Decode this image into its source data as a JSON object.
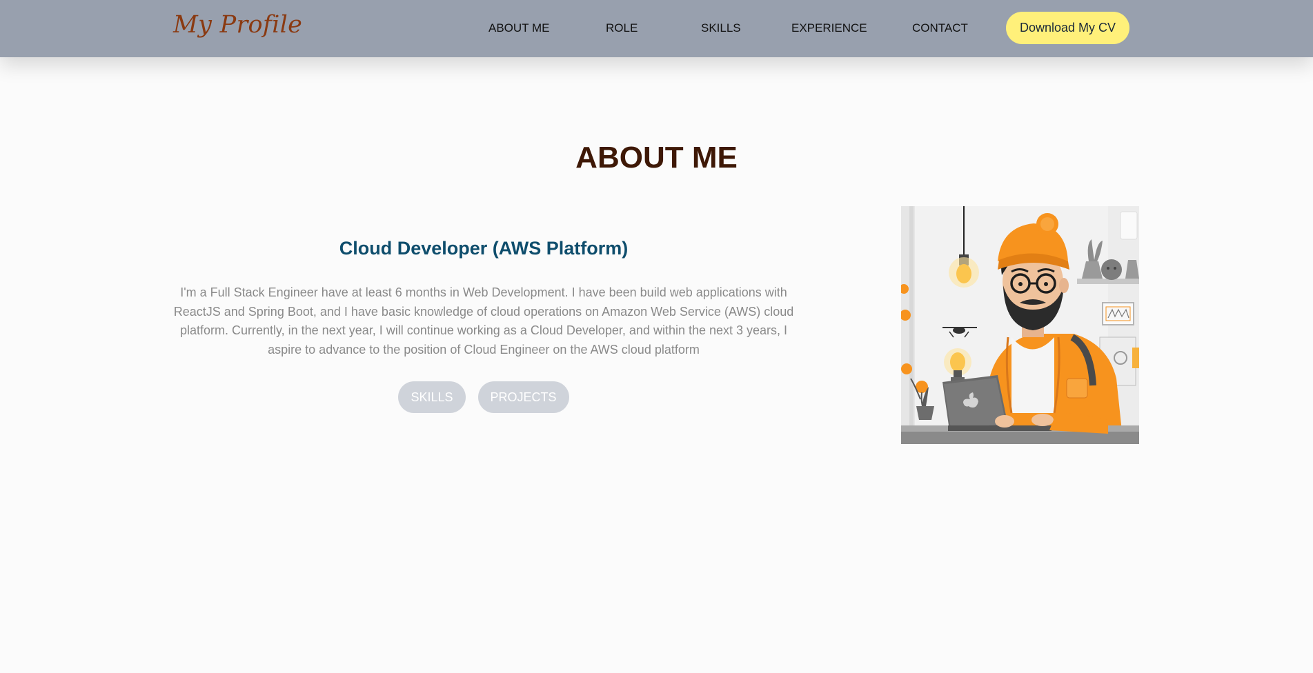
{
  "nav": {
    "brand": "My Profile",
    "links": [
      "ABOUT ME",
      "ROLE",
      "SKILLS",
      "EXPERIENCE",
      "CONTACT"
    ],
    "cv_button": "Download My CV"
  },
  "about": {
    "title": "ABOUT ME",
    "role": "Cloud Developer (AWS Platform)",
    "description": "I'm a Full Stack Engineer have at least 6 months in Web Development. I have been build web applications with ReactJS and Spring Boot, and I have basic knowledge of cloud operations on Amazon Web Service (AWS) cloud platform. Currently, in the next year, I will continue working as a Cloud Developer, and within the next 3 years, I aspire to advance to the position of Cloud Engineer on the AWS cloud platform",
    "buttons": [
      "SKILLS",
      "PROJECTS"
    ],
    "image": "developer-illustration"
  },
  "colors": {
    "navbar": "#98a0ae",
    "brand": "#8a3a12",
    "cv_button": "#fff07a",
    "title": "#3e1806",
    "role": "#0e4d6c",
    "pill": "#cfd3da",
    "accent_orange": "#f7931e"
  }
}
